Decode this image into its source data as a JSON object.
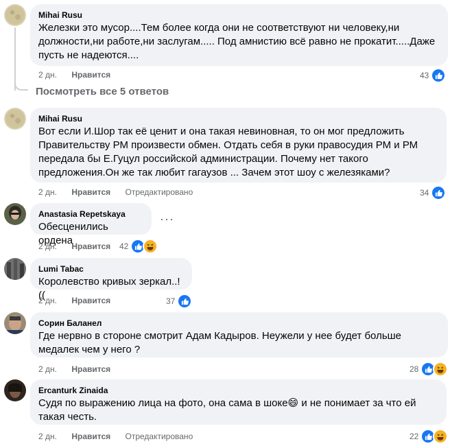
{
  "thread": {
    "view_replies": "Посмотреть все 5 ответов"
  },
  "colors": {
    "like": "#1877f2",
    "haha": "#f7b125",
    "meta": "#65676b",
    "bubble": "#f0f2f5"
  },
  "comments": [
    {
      "author": "Mihai Rusu",
      "text": "Железки это мусор....Тем более когда они не соответствуют ни человеку,ни\nдолжности,ни работе,ни заслугам..... Под амнистию всё равно не прокатит.....Даже\nпусть не надеются....",
      "time": "2 дн.",
      "like": "Нравится",
      "edited": "",
      "reactions_count": "43",
      "reaction_icons": [
        "like-icon"
      ]
    },
    {
      "author": "Mihai Rusu",
      "text": "Вот если И.Шор так её ценит и она такая невиновная, то он мог предложить\nПравительству РМ произвести обмен. Отдать себя в руки правосудия РМ и РМ\nпередала бы Е.Гуцул российской администрации. Почему нет такого\nпредложения.Он же так любит гагаузов ... Зачем этот шоу с железяками?",
      "time": "2 дн.",
      "like": "Нравится",
      "edited": "Отредактировано",
      "reactions_count": "34",
      "reaction_icons": [
        "like-icon"
      ]
    },
    {
      "author": "Anastasia Repetskaya",
      "text": "Обесценились ордена",
      "time": "2 дн.",
      "like": "Нравится",
      "edited": "",
      "reactions_count": "42",
      "reaction_icons": [
        "like-icon",
        "haha-icon"
      ],
      "more": "···"
    },
    {
      "author": "Lumi Tabac",
      "text": "Королевство кривых зеркал..!((",
      "time": "2 дн.",
      "like": "Нравится",
      "edited": "",
      "reactions_count": "37",
      "reaction_icons": [
        "like-icon"
      ]
    },
    {
      "author": "Сорин Баланел",
      "text": "Где нервно в стороне смотрит Адам Кадыров. Неужели у нее будет больше\nмедалек чем у него ?",
      "time": "2 дн.",
      "like": "Нравится",
      "edited": "",
      "reactions_count": "28",
      "reaction_icons": [
        "like-icon",
        "haha-icon"
      ]
    },
    {
      "author": "Ercanturk Zinaida",
      "text": "Судя по выражению лица на фото, она сама в шоке😄 и не понимает за что ей\nтакая честь.",
      "time": "2 дн.",
      "like": "Нравится",
      "edited": "Отредактировано",
      "reactions_count": "22",
      "reaction_icons": [
        "like-icon",
        "haha-icon"
      ]
    }
  ]
}
